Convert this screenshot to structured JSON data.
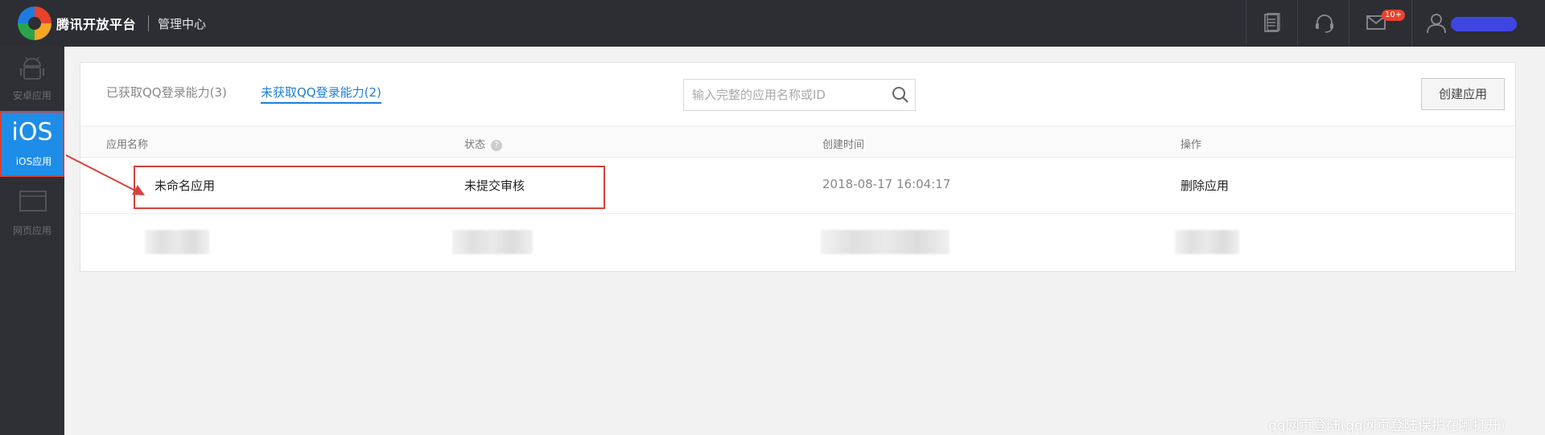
{
  "topbar": {
    "brand": "腾讯开放平台",
    "center_title": "管理中心",
    "messages_badge": "10+"
  },
  "sidebar": {
    "items": [
      {
        "label": "安卓应用",
        "icon": "android-icon"
      },
      {
        "label": "iOS应用",
        "glyph": "iOS",
        "icon": "ios-icon"
      },
      {
        "label": "网页应用",
        "icon": "browser-window-icon"
      }
    ]
  },
  "tabs": [
    {
      "label": "已获取QQ登录能力(3)"
    },
    {
      "label": "未获取QQ登录能力(2)"
    }
  ],
  "search": {
    "placeholder": "输入完整的应用名称或ID"
  },
  "create_button": "创建应用",
  "table": {
    "headers": [
      "应用名称",
      "状态",
      "创建时间",
      "操作"
    ],
    "help_glyph": "?",
    "rows": [
      {
        "name": "未命名应用",
        "status": "未提交审核",
        "created": "2018-08-17 16:04:17",
        "action": "删除应用"
      }
    ]
  },
  "watermark": "qq网页登陆(qq网页登陆保护在哪打开)",
  "colors": {
    "accent": "#1e7fd8",
    "highlight": "#d6423b",
    "topbar": "#2c2e33",
    "sidebar": "#2f3035"
  }
}
